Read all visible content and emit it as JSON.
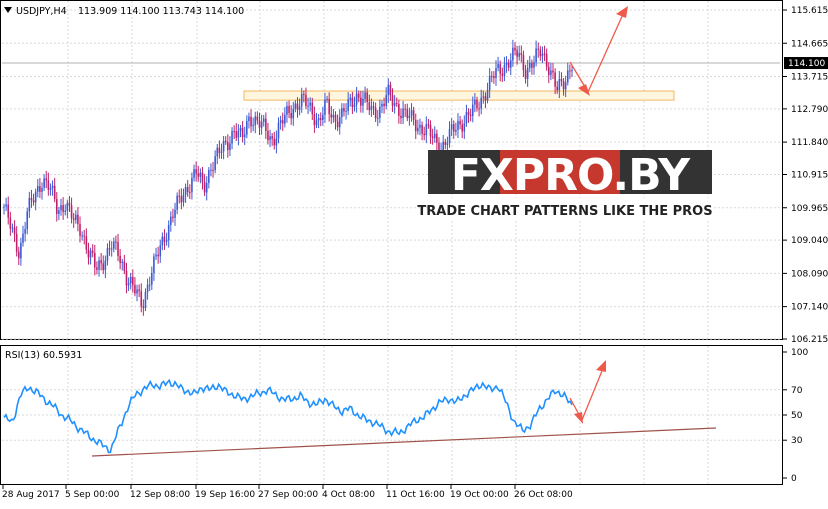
{
  "header": {
    "menu_icon": "triangle-down-icon",
    "title": "USDJPY,H4",
    "ohlc": "113.909 114.100 113.743 114.100"
  },
  "watermark": {
    "logo": "FXPRO.BY",
    "tagline": "TRADE CHART PATTERNS LIKE THE PROS"
  },
  "rsi_panel": {
    "label": "RSI(13) 60.5931"
  },
  "colors": {
    "bull": "#3b5bd6",
    "bear": "#c02068",
    "rsi": "#1e90ff",
    "trendline": "#a0524a",
    "arrow": "#f05a4a",
    "zone_border": "#f0b860",
    "zone_fill": "#fff6e0",
    "grid": "#d9d9d9"
  },
  "chart_data": [
    {
      "type": "candlestick",
      "title": "USDJPY,H4",
      "y_ticks": [
        "115.615",
        "114.665",
        "113.715",
        "112.790",
        "111.840",
        "110.915",
        "109.965",
        "109.040",
        "108.090",
        "107.140",
        "106.215"
      ],
      "current_price": "114.100",
      "ylim": [
        106.215,
        115.615
      ],
      "x_ticks": [
        "28 Aug 2017",
        "5 Sep 00:00",
        "12 Sep 08:00",
        "19 Sep 16:00",
        "27 Sep 00:00",
        "4 Oct 08:00",
        "11 Oct 16:00",
        "19 Oct 00:00",
        "26 Oct 08:00"
      ],
      "close_path": [
        110.0,
        109.3,
        108.7,
        109.8,
        110.3,
        110.8,
        110.5,
        109.9,
        110.1,
        109.6,
        109.4,
        108.7,
        108.2,
        108.5,
        108.9,
        108.6,
        108.0,
        107.6,
        107.2,
        108.0,
        108.6,
        109.2,
        109.8,
        110.2,
        110.6,
        111.0,
        110.5,
        111.2,
        111.5,
        111.8,
        112.2,
        111.9,
        112.6,
        112.4,
        112.2,
        111.9,
        112.3,
        112.7,
        112.9,
        113.0,
        112.8,
        112.4,
        112.9,
        112.5,
        112.6,
        112.9,
        113.2,
        113.0,
        112.7,
        112.8,
        113.2,
        112.9,
        112.7,
        112.5,
        112.3,
        112.2,
        111.9,
        111.7,
        112.0,
        112.3,
        112.5,
        112.7,
        113.0,
        113.4,
        113.8,
        114.0,
        114.2,
        114.4,
        113.9,
        114.1,
        114.5,
        114.0,
        113.3,
        113.6,
        114.1
      ],
      "resistance_zone": [
        113.04,
        113.3
      ],
      "projection": "up"
    },
    {
      "type": "line",
      "name": "RSI(13)",
      "ylim": [
        0,
        100
      ],
      "y_ticks": [
        "100",
        "70",
        "50",
        "30",
        "0"
      ],
      "values": [
        48,
        44,
        66,
        72,
        68,
        62,
        57,
        50,
        46,
        40,
        35,
        30,
        26,
        22,
        40,
        55,
        67,
        70,
        75,
        72,
        77,
        73,
        70,
        66,
        72,
        70,
        74,
        68,
        66,
        62,
        65,
        67,
        70,
        66,
        62,
        63,
        65,
        60,
        58,
        63,
        57,
        53,
        55,
        50,
        46,
        44,
        40,
        36,
        36,
        40,
        46,
        48,
        55,
        60,
        63,
        60,
        66,
        70,
        75,
        70,
        73,
        60,
        44,
        38,
        42,
        55,
        62,
        70,
        65,
        58
      ],
      "trendline": [
        20,
        40
      ],
      "projection": "up"
    }
  ]
}
